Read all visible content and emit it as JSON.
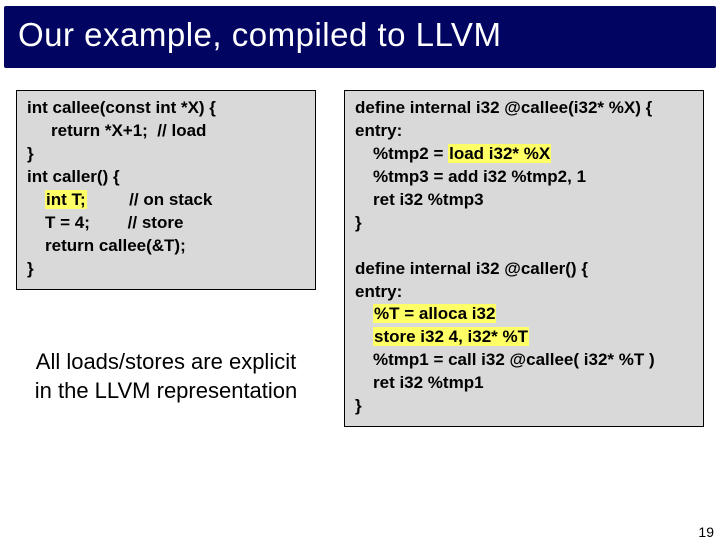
{
  "title": "Our example, compiled to LLVM",
  "left": {
    "l1": "int callee(const int *X) {",
    "l2a": "return *X+1;",
    "l2b": "// load",
    "l3": "}",
    "l4": "int caller() {",
    "l5a": "int T;",
    "l5b": "// on stack",
    "l6a": "T = 4;",
    "l6b": "// store",
    "l7": "return callee(&T);",
    "l8": "}"
  },
  "right": {
    "a1": "define internal i32 @callee(i32* %X) {",
    "a2": "entry:",
    "a3a": "%tmp2 =",
    "a3b": "load i32* %X",
    "a4": "%tmp3 = add i32 %tmp2, 1",
    "a5": "ret i32 %tmp3",
    "a6": "}",
    "b1": "define internal i32 @caller() {",
    "b2": "entry:",
    "b3": "%T = alloca i32",
    "b4": "store i32 4, i32* %T",
    "b5": "%tmp1 = call i32 @callee( i32* %T )",
    "b6": "ret i32 %tmp1",
    "b7": "}"
  },
  "note": "All loads/stores are explicit in the LLVM representation",
  "page": "19"
}
